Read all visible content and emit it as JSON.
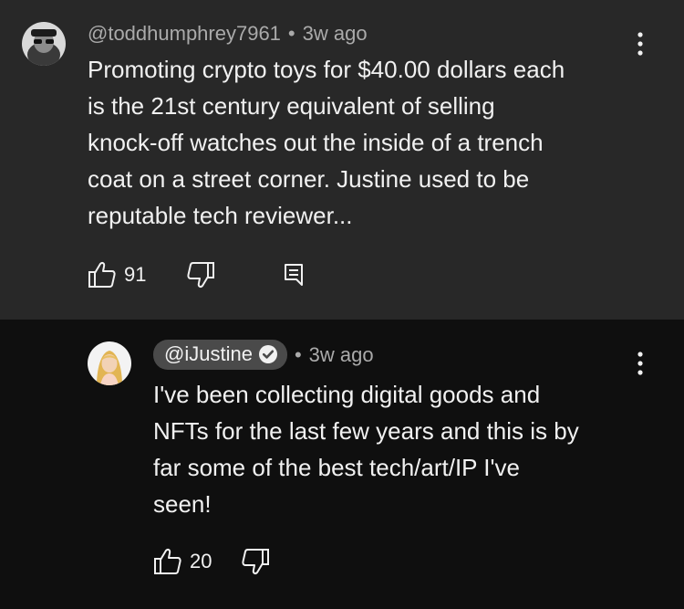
{
  "comment": {
    "username": "@toddhumphrey7961",
    "time": "3w ago",
    "lines": [
      "Promoting crypto toys for $40.00 dollars each",
      "is the 21st century equivalent of selling",
      "knock-off watches out the inside of a trench",
      "coat on a street corner.  Justine used to be",
      "reputable tech reviewer..."
    ],
    "like_count": "91",
    "icons": {
      "like": "thumbs-up-icon",
      "dislike": "thumbs-down-icon",
      "reply": "comment-icon",
      "menu": "more-vertical-icon"
    }
  },
  "reply": {
    "username": "@iJustine",
    "verified_icon": "verified-check-icon",
    "time": "3w ago",
    "lines": [
      "I've been collecting digital goods and",
      "NFTs for the last few years and this is by",
      "far some of the best tech/art/IP I've",
      "seen!"
    ],
    "like_count": "20",
    "icons": {
      "like": "thumbs-up-icon",
      "dislike": "thumbs-down-icon",
      "menu": "more-vertical-icon"
    }
  },
  "colors": {
    "top_background": "#282828",
    "bottom_background": "#0f0f0f",
    "text_primary": "#f1f1f1",
    "text_secondary": "#aaaaaa",
    "handle_chip": "#4a4a4a"
  }
}
